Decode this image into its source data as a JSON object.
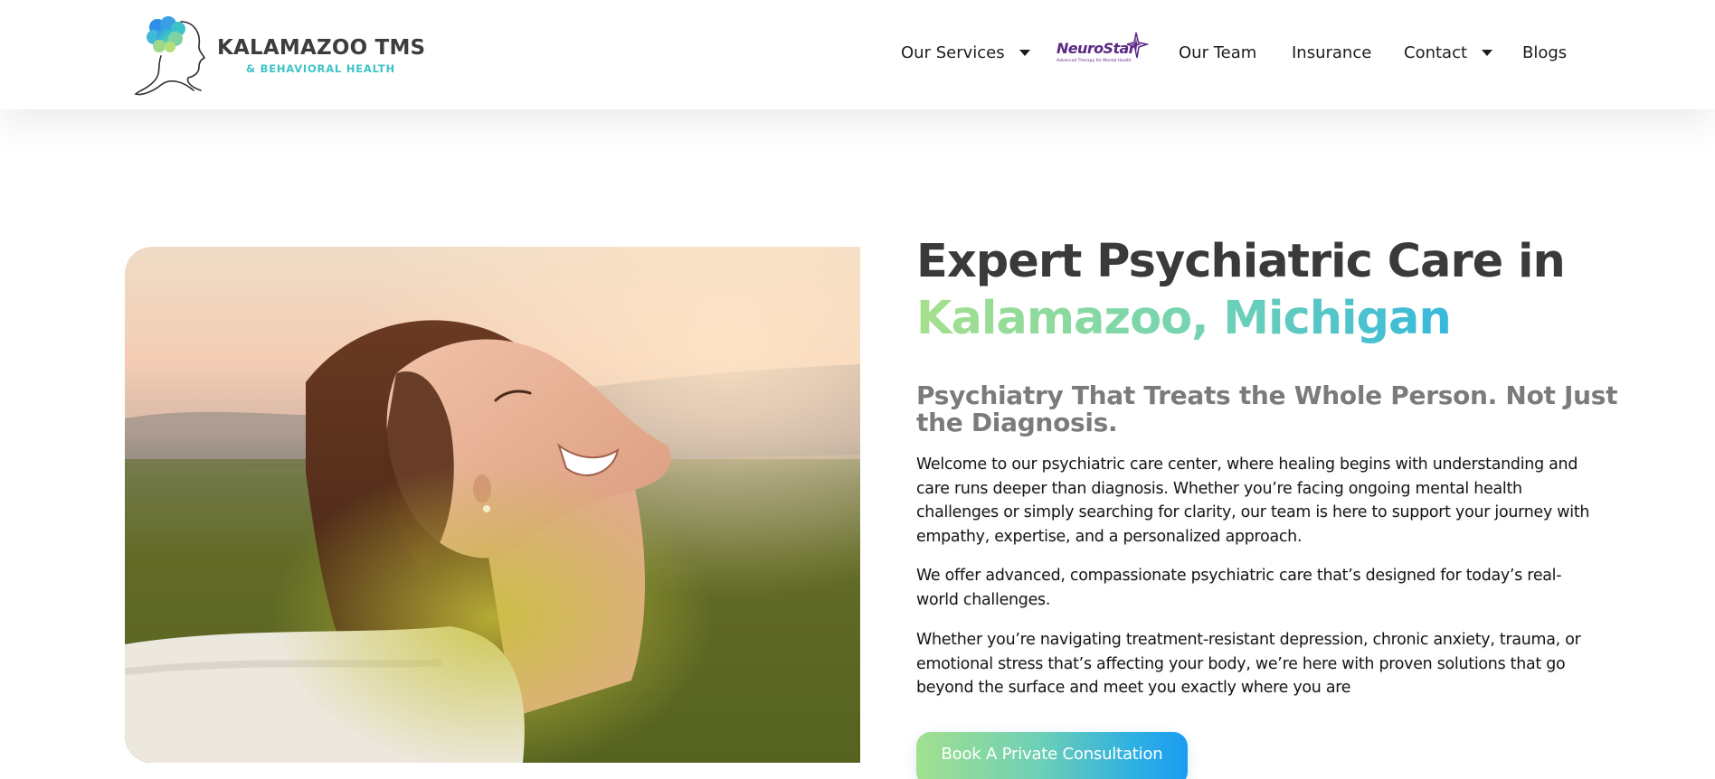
{
  "brand": {
    "name": "KALAMAZOO TMS",
    "tagline": "& BEHAVIORAL HEALTH",
    "colors": {
      "title": "#3d3d3d",
      "tagline": "#3cc3c8",
      "gradient_start": "#a3e08f",
      "gradient_end": "#1a9cf2"
    }
  },
  "nav": {
    "items": [
      {
        "label": "Our Services",
        "has_dropdown": true
      },
      {
        "label": "NeuroStar",
        "tagline": "Advanced Therapy for Mental Health",
        "is_logo": true
      },
      {
        "label": "Our Team",
        "has_dropdown": false
      },
      {
        "label": "Insurance",
        "has_dropdown": false
      },
      {
        "label": "Contact",
        "has_dropdown": true
      },
      {
        "label": "Blogs",
        "has_dropdown": false
      }
    ]
  },
  "hero": {
    "image_alt": "Smiling woman with eyes closed enjoying the sun in a meadow",
    "headline_line1": "Expert Psychiatric Care in",
    "headline_line2": "Kalamazoo, Michigan",
    "subheadline": "Psychiatry That Treats the Whole Person. Not Just the Diagnosis.",
    "paragraphs": [
      "Welcome to our psychiatric care center, where healing begins with understanding and care runs deeper than diagnosis. Whether you’re facing ongoing mental health challenges or simply searching for clarity, our team is here to support your journey with empathy, expertise, and a personalized approach.",
      "We offer advanced, compassionate psychiatric care that’s designed for today’s real-world challenges.",
      "Whether you’re navigating treatment-resistant depression, chronic anxiety, trauma, or emotional stress that’s affecting your body, we’re here with proven solutions that go beyond the surface and meet you exactly where you are"
    ],
    "cta_label": "Book A Private Consultation"
  }
}
